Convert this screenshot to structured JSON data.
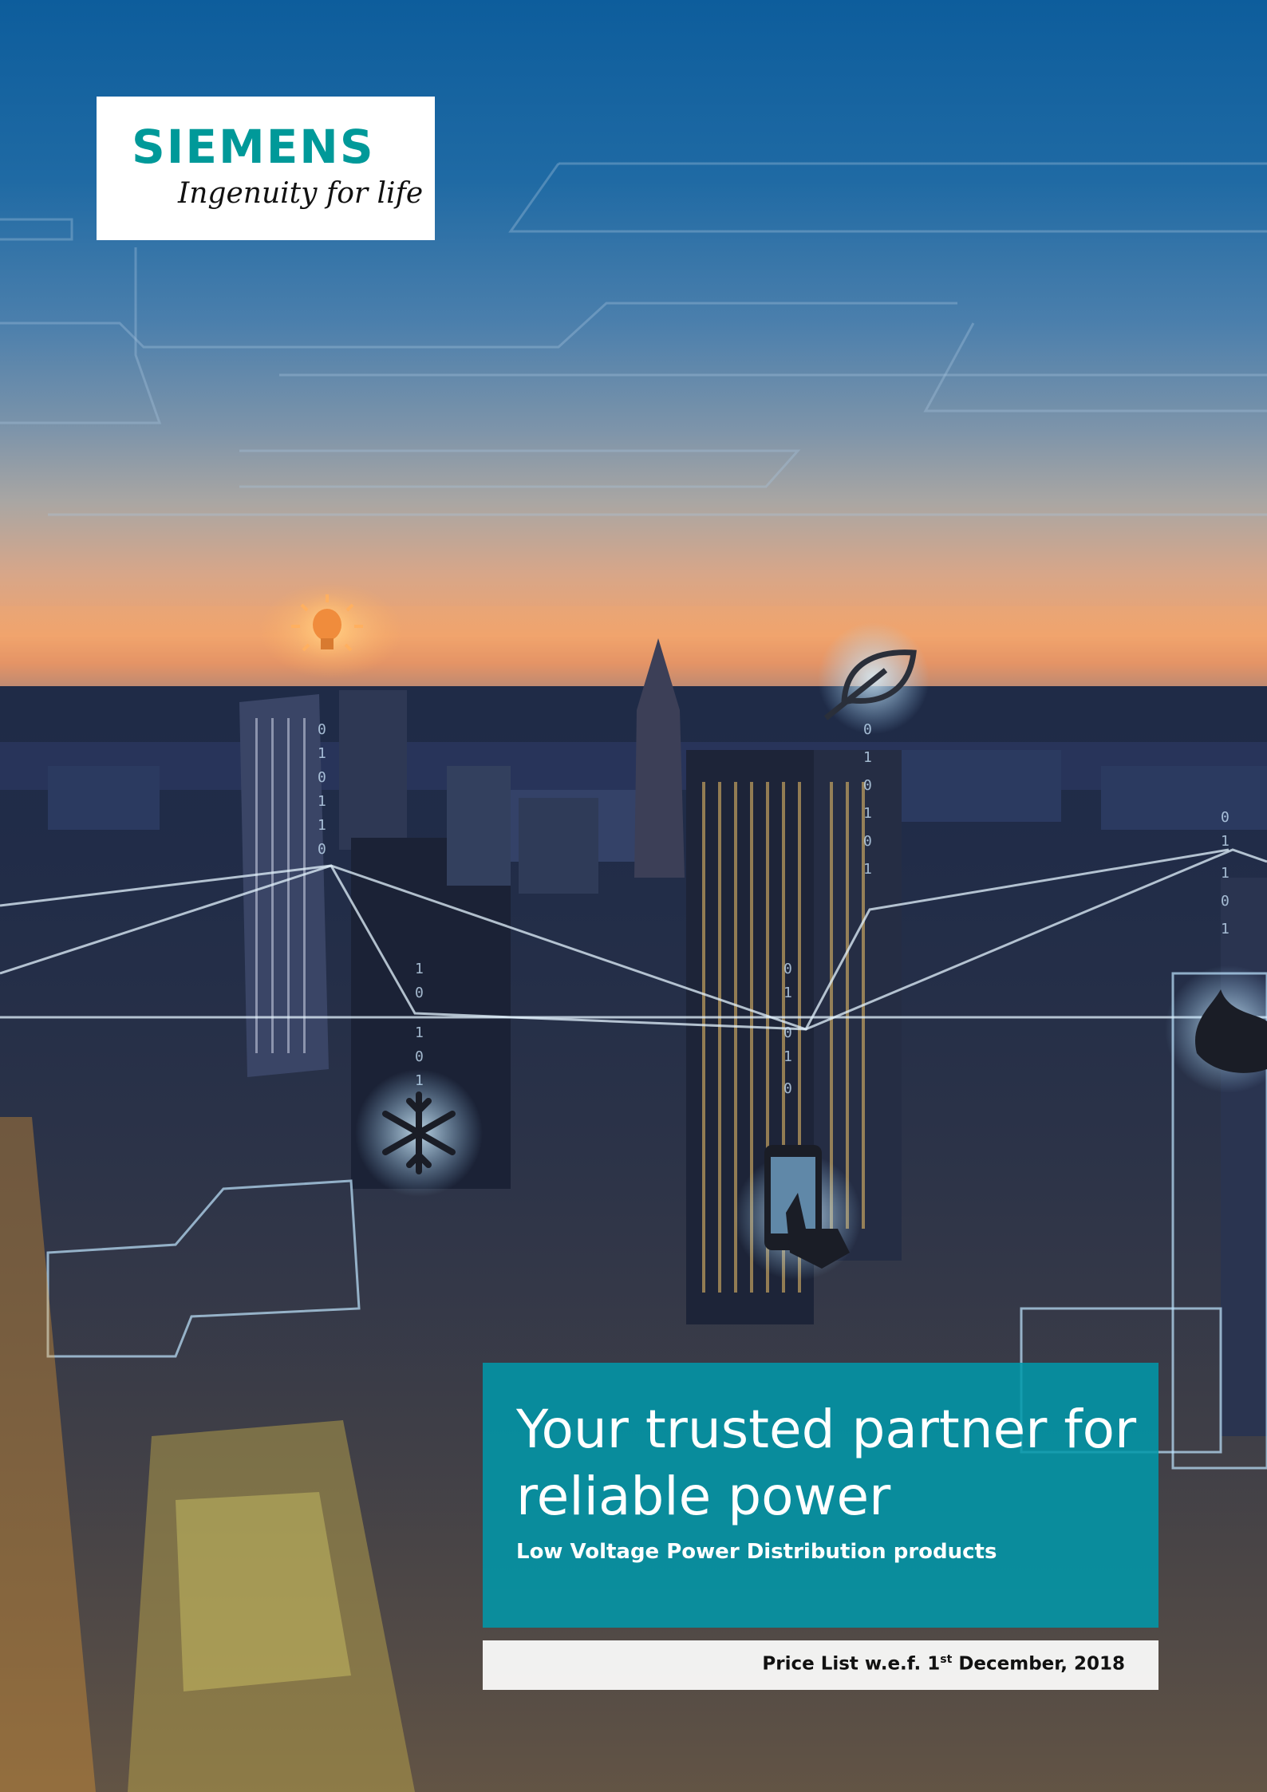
{
  "brand": {
    "name": "SIEMENS",
    "tagline": "Ingenuity for life",
    "color": "#009999"
  },
  "headline": "Your trusted partner for reliable power",
  "subheadline": "Low Voltage Power Distribution products",
  "price_list": {
    "prefix": "Price List w.e.f. 1",
    "superscript": "st",
    "suffix": " December, 2018"
  },
  "colors": {
    "headline_box": "#0099aa",
    "sky_top": "#0d5d9c",
    "horizon": "#f0a36c",
    "city": "#1c2a44"
  },
  "icons": [
    "lightbulb-icon",
    "leaf-icon",
    "snowflake-icon",
    "touch-phone-icon",
    "flame-icon"
  ]
}
